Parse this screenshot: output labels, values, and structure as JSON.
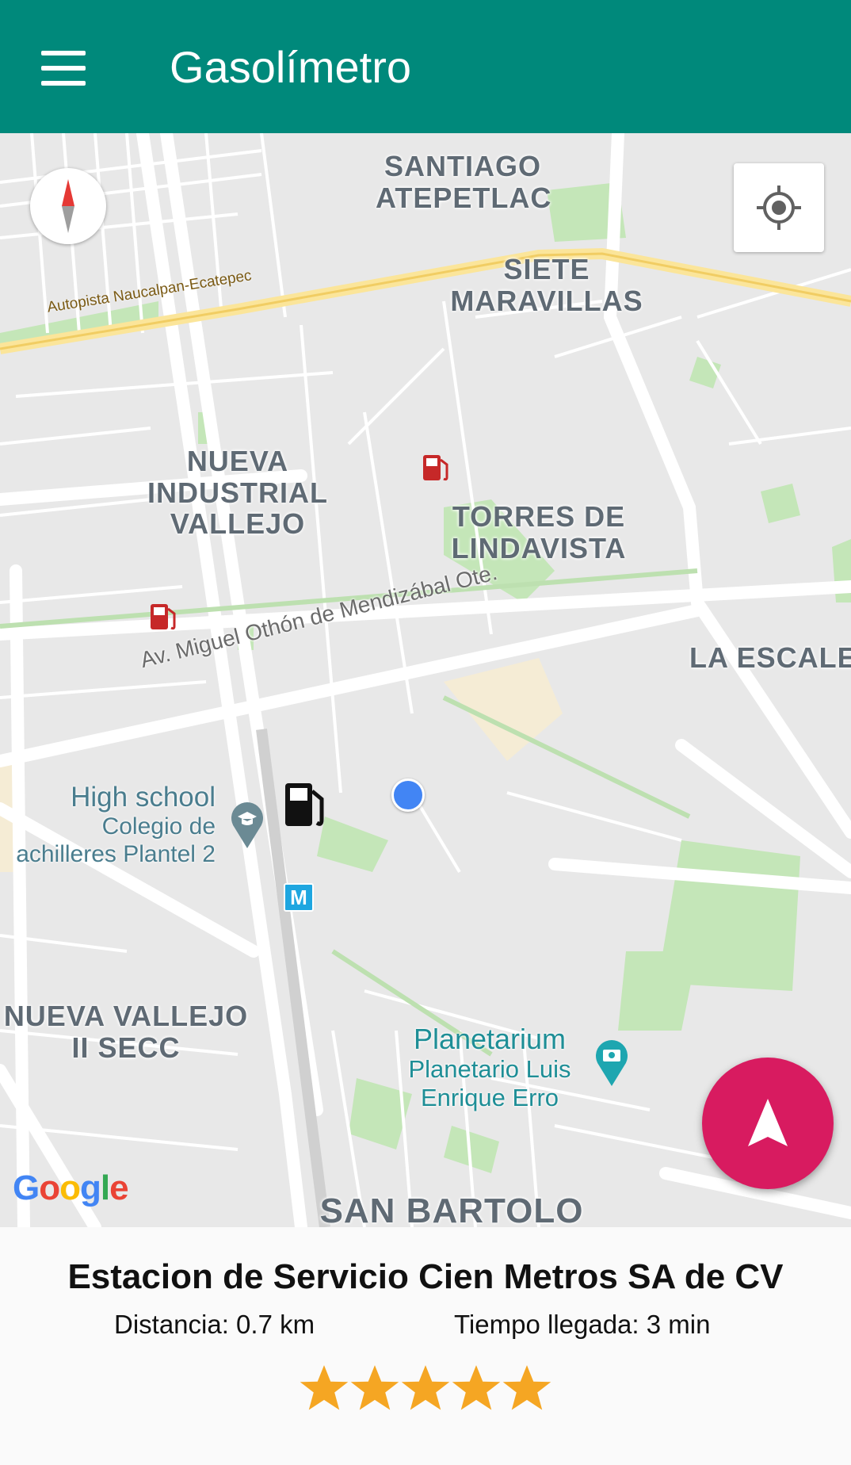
{
  "app": {
    "title": "Gasolímetro"
  },
  "map": {
    "neighborhoods": {
      "santiago": [
        "SANTIAGO",
        "ATEPETLAC"
      ],
      "siete": [
        "SIETE",
        "MARAVILLAS"
      ],
      "nueva_industrial": [
        "NUEVA",
        "INDUSTRIAL",
        "VALLEJO"
      ],
      "torres": [
        "TORRES DE",
        "LINDAVISTA"
      ],
      "escalera": "LA ESCALE",
      "nueva_vallejo": [
        "NUEVA VALLEJO",
        "II SECC"
      ],
      "san_bartolo": "SAN BARTOLO"
    },
    "streets": {
      "autopista": "Autopista Naucalpan-Ecatepec",
      "miguel_othon": "Av. Miguel Othón de Mendizábal Ote."
    },
    "pois": {
      "school": [
        "High school",
        "Colegio de",
        "achilleres Plantel 2"
      ],
      "planetarium": [
        "Planetarium",
        "Planetario Luis",
        "Enrique Erro"
      ]
    },
    "metro_letter": "M",
    "google_logo": "Google",
    "colors": {
      "roads": "#ffffff",
      "parks": "#c4e6b8",
      "highway": "#fbe59a",
      "poi_sand": "#f5ecd5",
      "fuel_icon": "#c62828",
      "user_dot": "#4285f4"
    }
  },
  "station": {
    "name": "Estacion de Servicio Cien Metros SA de CV",
    "distance": "Distancia: 0.7 km",
    "eta": "Tiempo llegada: 3 min",
    "rating": 5,
    "rating_max": 5
  },
  "theme": {
    "primary": "#00897b",
    "accent": "#d81b60",
    "star": "#f5a623"
  }
}
